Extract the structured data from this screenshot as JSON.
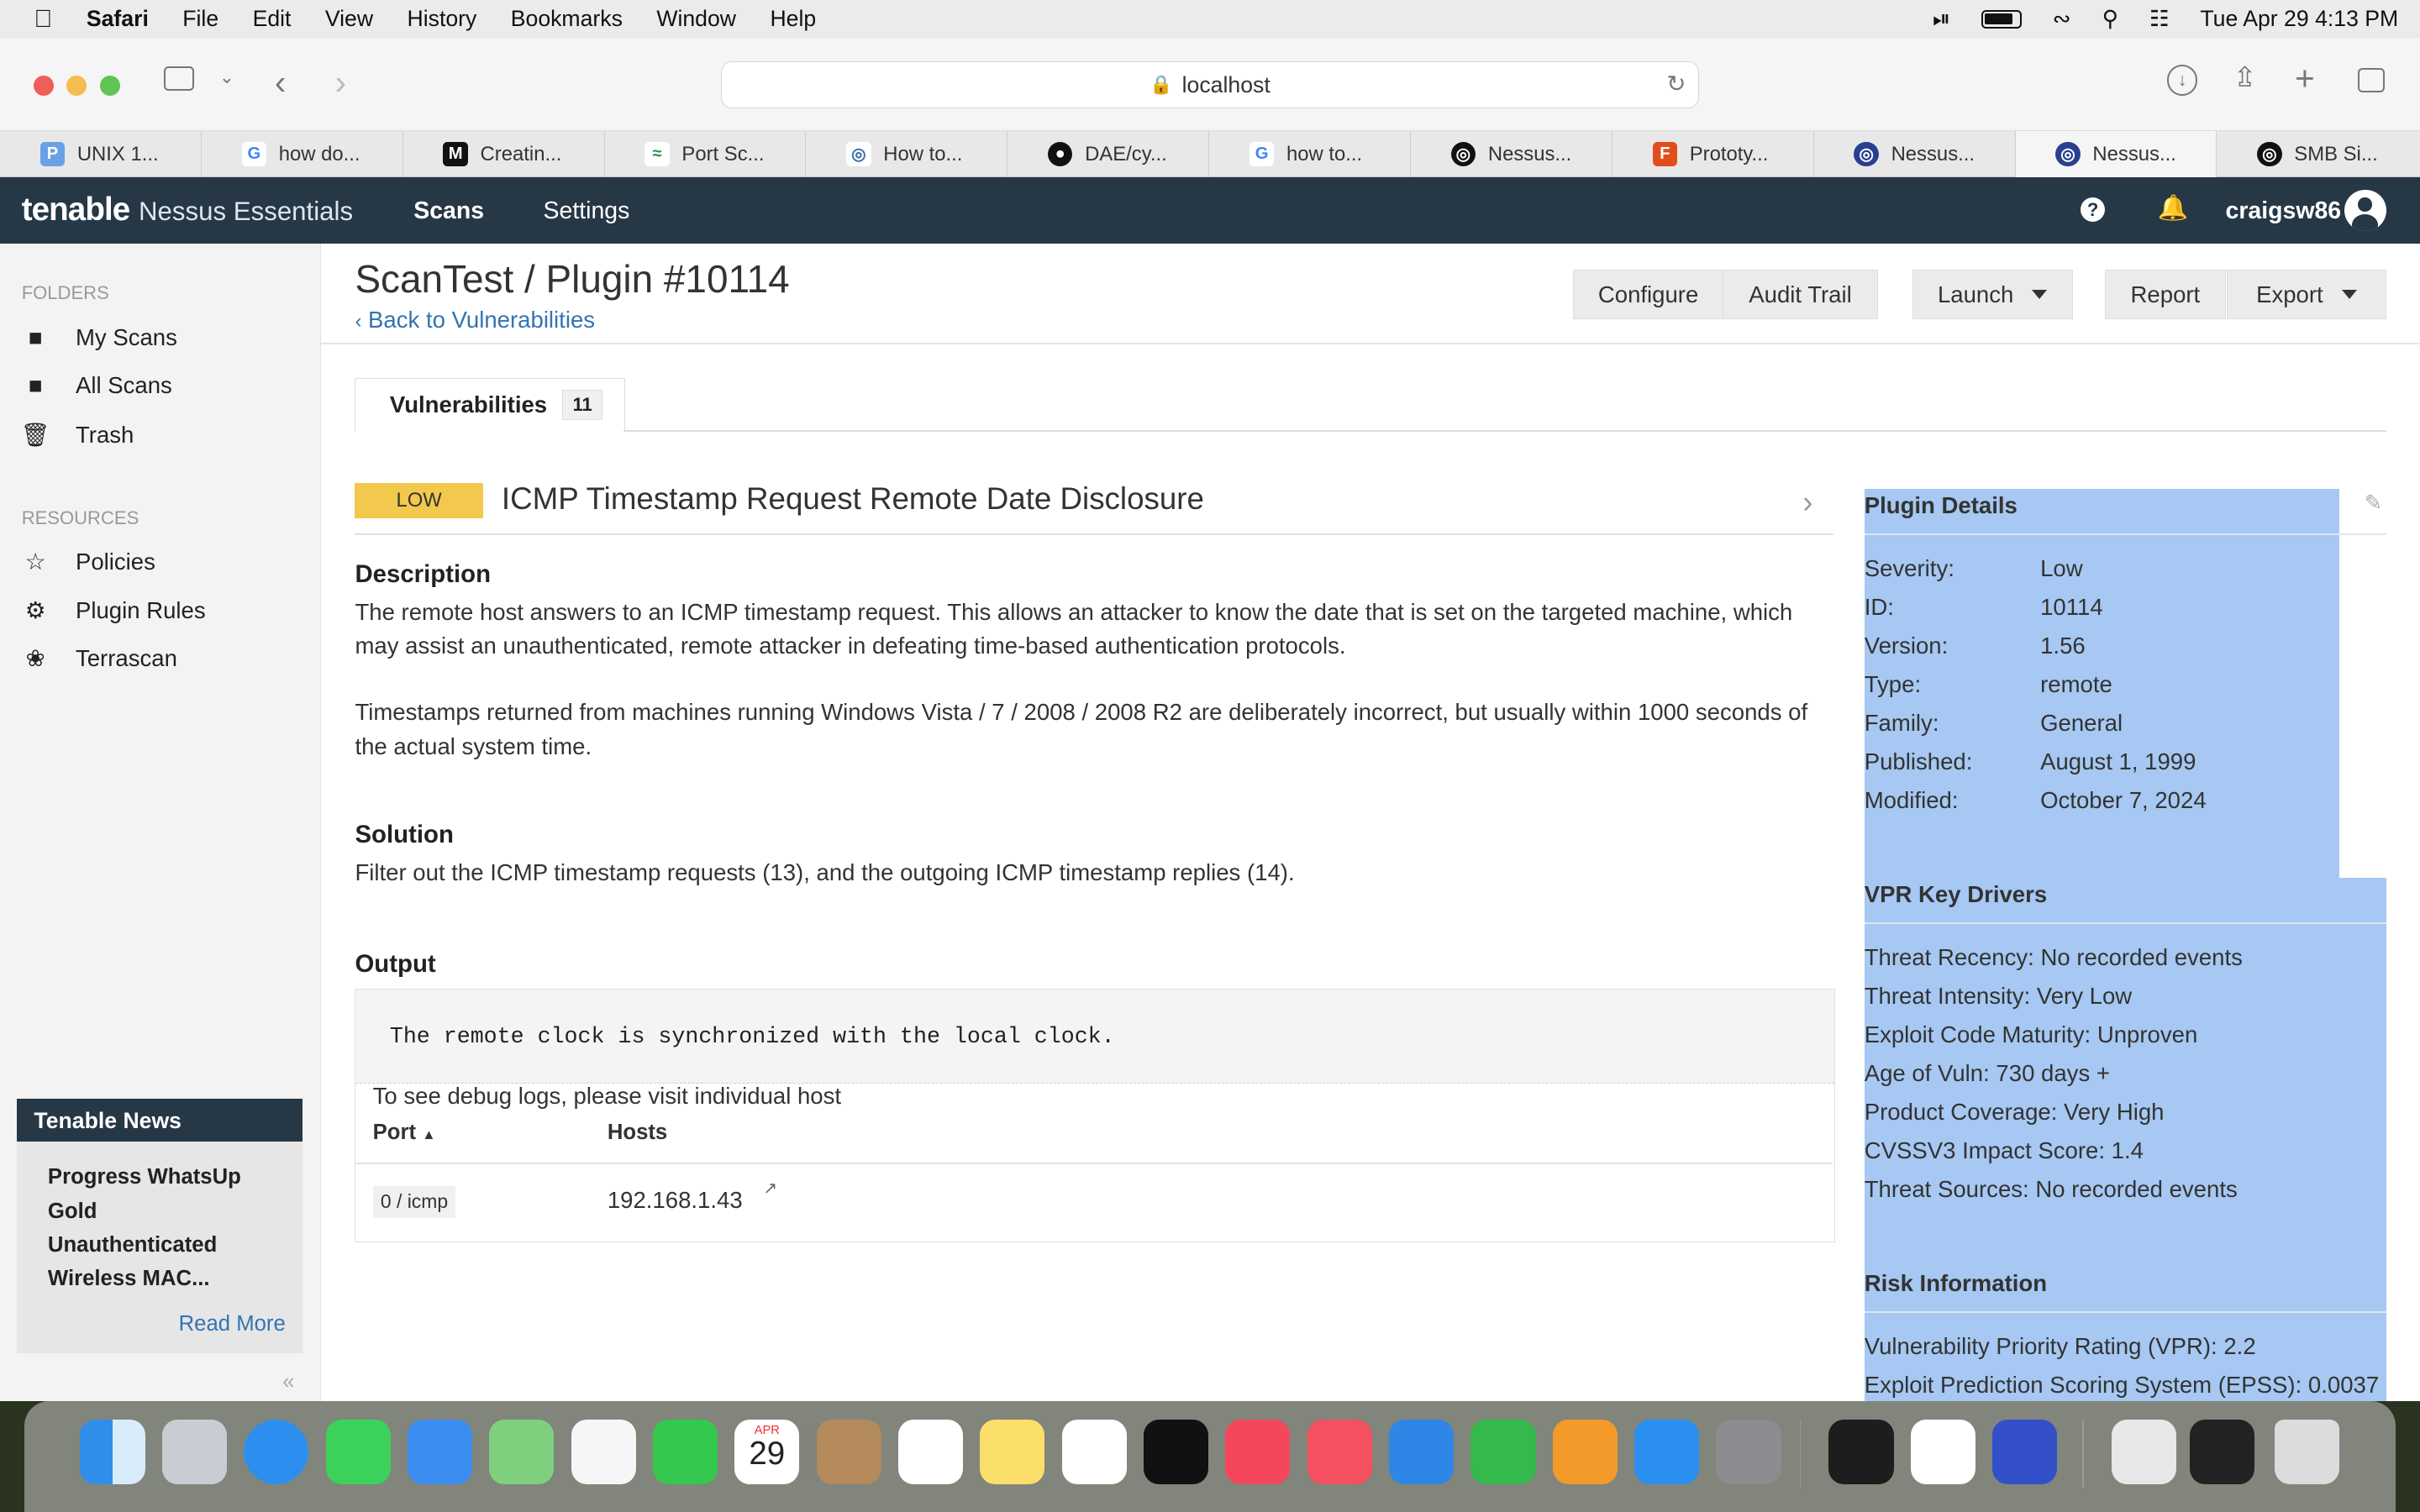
{
  "menubar": {
    "app": "Safari",
    "items": [
      "File",
      "Edit",
      "View",
      "History",
      "Bookmarks",
      "Window",
      "Help"
    ],
    "datetime": "Tue Apr 29  4:13 PM"
  },
  "browser": {
    "url": "localhost",
    "tabs": [
      {
        "label": "UNIX 1...",
        "color": "#6aa1e6",
        "glyph": "P"
      },
      {
        "label": "how do...",
        "color": "#4285f4",
        "glyph": "G"
      },
      {
        "label": "Creatin...",
        "color": "#111111",
        "glyph": "M"
      },
      {
        "label": "Port Sc...",
        "color": "#2f8d46",
        "glyph": "≈"
      },
      {
        "label": "How to...",
        "color": "#3b6ea8",
        "glyph": "◎"
      },
      {
        "label": "DAE/cy...",
        "color": "#111111",
        "glyph": "●"
      },
      {
        "label": "how to...",
        "color": "#4285f4",
        "glyph": "G"
      },
      {
        "label": "Nessus...",
        "color": "#111111",
        "glyph": "◎"
      },
      {
        "label": "Prototy...",
        "color": "#e24e1b",
        "glyph": "F"
      },
      {
        "label": "Nessus...",
        "color": "#2b3f8f",
        "glyph": "◎"
      },
      {
        "label": "Nessus...",
        "color": "#2b3f8f",
        "glyph": "◎"
      },
      {
        "label": "SMB Si...",
        "color": "#111111",
        "glyph": "◎"
      }
    ],
    "active_tab_index": 10
  },
  "app": {
    "logo_brand": "tenable",
    "logo_product": "Nessus Essentials",
    "nav": {
      "scans": "Scans",
      "settings": "Settings"
    },
    "user": "craigsw86"
  },
  "sidebar": {
    "folders_label": "FOLDERS",
    "folders": [
      "My Scans",
      "All Scans",
      "Trash"
    ],
    "resources_label": "RESOURCES",
    "resources": [
      "Policies",
      "Plugin Rules",
      "Terrascan"
    ],
    "news": {
      "title": "Tenable News",
      "body": "Progress WhatsUp Gold Unauthenticated Wireless MAC...",
      "read_more": "Read More"
    }
  },
  "page": {
    "title": "ScanTest / Plugin #10114",
    "back": "Back to Vulnerabilities",
    "buttons": {
      "configure": "Configure",
      "audit": "Audit Trail",
      "launch": "Launch",
      "report": "Report",
      "export": "Export"
    },
    "tab_label": "Vulnerabilities",
    "tab_count": "11",
    "severity": "LOW",
    "severity_color": "#f2c94c",
    "vuln_title": "ICMP Timestamp Request Remote Date Disclosure",
    "description_h": "Description",
    "description_1": "The remote host answers to an ICMP timestamp request. This allows an attacker to know the date that is set on the targeted machine, which may assist an unauthenticated, remote attacker in defeating time-based authentication protocols.",
    "description_2": "Timestamps returned from machines running Windows Vista / 7 / 2008 / 2008 R2 are deliberately incorrect, but usually within 1000 seconds of the actual system time.",
    "solution_h": "Solution",
    "solution": "Filter out the ICMP timestamp requests (13), and the outgoing ICMP timestamp replies (14).",
    "output_h": "Output",
    "output": "The remote clock is synchronized with the local clock.",
    "debug": "To see debug logs, please visit individual host",
    "col_port": "Port",
    "col_hosts": "Hosts",
    "port": "0 / icmp",
    "host": "192.168.1.43"
  },
  "details": {
    "title": "Plugin Details",
    "rows": [
      {
        "k": "Severity:",
        "v": "Low"
      },
      {
        "k": "ID:",
        "v": "10114"
      },
      {
        "k": "Version:",
        "v": "1.56"
      },
      {
        "k": "Type:",
        "v": "remote"
      },
      {
        "k": "Family:",
        "v": "General"
      },
      {
        "k": "Published:",
        "v": "August 1, 1999"
      },
      {
        "k": "Modified:",
        "v": "October 7, 2024"
      }
    ],
    "vpr_title": "VPR Key Drivers",
    "vpr": [
      "Threat Recency: No recorded events",
      "Threat Intensity: Very Low",
      "Exploit Code Maturity: Unproven",
      "Age of Vuln: 730 days +",
      "Product Coverage: Very High",
      "CVSSV3 Impact Score: 1.4",
      "Threat Sources: No recorded events"
    ],
    "risk_title": "Risk Information",
    "risk": [
      "Vulnerability Priority Rating (VPR): 2.2",
      "Exploit Prediction Scoring System (EPSS): 0.0037"
    ]
  },
  "dock": {
    "calendar_month": "APR",
    "calendar_day": "29",
    "apps": [
      "Finder",
      "Launchpad",
      "Safari",
      "Messages",
      "Mail",
      "Maps",
      "Photos",
      "FaceTime",
      "Calendar",
      "Contacts",
      "Reminders",
      "Notes",
      "Freeform",
      "TV",
      "Music",
      "News",
      "Keynote",
      "Numbers",
      "Pages",
      "App Store",
      "System Settings",
      "Terminal",
      "VS Code",
      "Nessus",
      "Preview",
      "Screen",
      "Trash"
    ]
  }
}
